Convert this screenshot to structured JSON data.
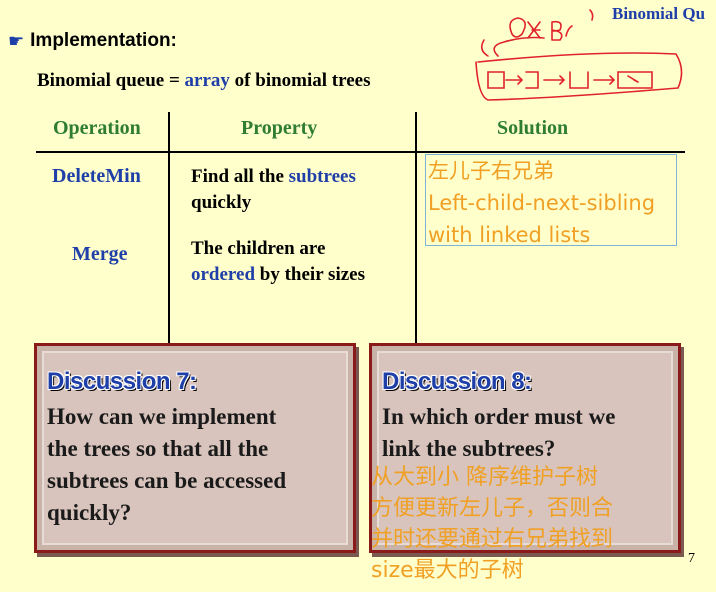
{
  "header": {
    "title_right": "Binomial Qu",
    "section_label": "Implementation:",
    "subtitle_prefix": "Binomial queue = ",
    "subtitle_highlight": "array",
    "subtitle_suffix": " of binomial trees"
  },
  "table": {
    "headers": [
      "Operation",
      "Property",
      "Solution"
    ],
    "rows": [
      {
        "operation": "DeleteMin",
        "property_a": "Find all the ",
        "property_hl": "subtrees",
        "property_b": "quickly"
      },
      {
        "operation": "Merge",
        "property_a": "The children are",
        "property_hl": "ordered",
        "property_b": " by their sizes"
      }
    ],
    "solution_note": [
      "左儿子右兄弟",
      "Left-child-next-sibling",
      "with linked lists"
    ]
  },
  "discussions": [
    {
      "title": "Discussion 7:",
      "body": [
        "How can we implement",
        "the trees so that all the",
        "subtrees can be accessed",
        "quickly?"
      ]
    },
    {
      "title": "Discussion 8:",
      "body": [
        "In which order must we",
        "link the subtrees?"
      ]
    }
  ],
  "handwritten_note": [
    "从大到小 降序维护子树",
    "方便更新左儿子，否则合",
    "并时还要通过右兄弟找到",
    "size最大的子树"
  ],
  "page_number": "7",
  "colors": {
    "background": "#FFFFCC",
    "blue": "#1F3FA8",
    "green": "#2E7D32",
    "annotation": "#F0A024",
    "scribble": "#E0222A"
  }
}
